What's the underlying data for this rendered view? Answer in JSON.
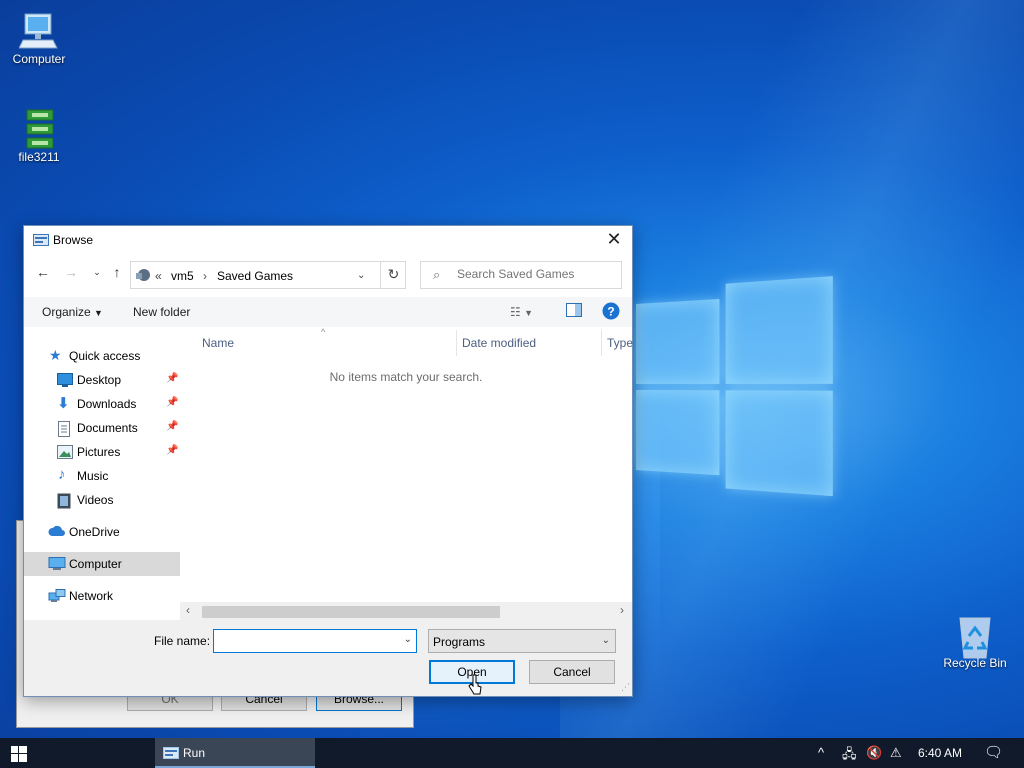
{
  "desktop": {
    "icons": [
      {
        "label": "Computer"
      },
      {
        "label": "file3211"
      },
      {
        "label": "Recycle Bin"
      }
    ]
  },
  "run_window": {
    "ok_label": "OK",
    "cancel_label": "Cancel",
    "browse_label": "Browse..."
  },
  "dialog": {
    "title": "Browse",
    "address": {
      "overflow": "«",
      "segments": [
        "vm5",
        "Saved Games"
      ]
    },
    "search_placeholder": "Search Saved Games",
    "toolbar": {
      "organize": "Organize",
      "new_folder": "New folder"
    },
    "nav": {
      "quick_access": "Quick access",
      "desktop": "Desktop",
      "downloads": "Downloads",
      "documents": "Documents",
      "pictures": "Pictures",
      "music": "Music",
      "videos": "Videos",
      "onedrive": "OneDrive",
      "computer": "Computer",
      "network": "Network"
    },
    "columns": {
      "name": "Name",
      "date_modified": "Date modified",
      "type": "Type"
    },
    "empty_message": "No items match your search.",
    "file_name_label": "File name:",
    "file_name_value": "",
    "file_type": "Programs",
    "open_label": "Open",
    "cancel_label": "Cancel"
  },
  "taskbar": {
    "running_app": "Run",
    "clock": "6:40 AM"
  },
  "colors": {
    "accent": "#0078d7",
    "taskbar": "#101a2a"
  }
}
